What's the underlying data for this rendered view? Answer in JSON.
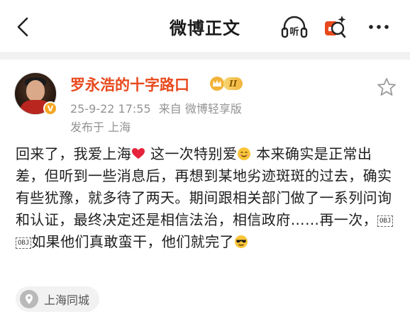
{
  "header": {
    "title": "微博正文",
    "listen_label": "听",
    "icons": [
      "back-arrow-icon",
      "listen-icon",
      "ai-assistant-icon",
      "more-icon"
    ]
  },
  "author": {
    "name": "罗永浩的十字路口",
    "level": "II",
    "avatar_caption": "罗永浩 的十字路口",
    "badge_color": "#f6a623",
    "name_color": "#e8491d"
  },
  "meta": {
    "timestamp": "25-9-22 17:55",
    "source": "来自 微博轻享版",
    "location": "发布于 上海"
  },
  "post": {
    "seg1": "回来了，我爱上海",
    "seg2": " 这一次特别爱",
    "seg3": " 本来确实是正常出差，但听到一些消息后，再想到某地劣迹斑斑的过去，确实有些犹豫，就多待了两天。期间跟相关部门做了一系列问询和认证，最终决定还是相信法治，相信政府……再一次，",
    "obj1": "OBJ",
    "obj2": "OBJ",
    "seg4": "如果他们真敢蛮干，他们就完了"
  },
  "location_chip": {
    "label": "上海同城"
  }
}
